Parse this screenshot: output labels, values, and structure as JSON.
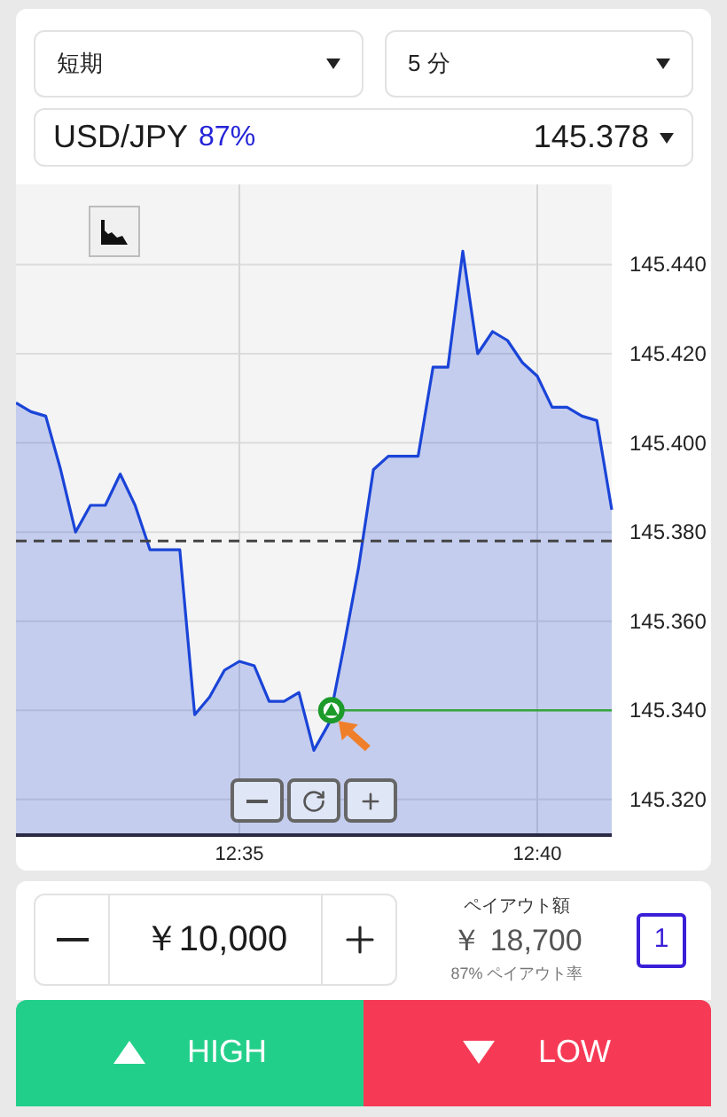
{
  "selectors": [
    {
      "value": "短期"
    },
    {
      "value": "5 分"
    }
  ],
  "asset": {
    "pair": "USD/JPY",
    "payout_rate": "87%",
    "price": "145.378"
  },
  "chart": {
    "chart_data": {
      "type": "area",
      "categories": [
        null,
        null,
        null,
        null,
        null,
        null,
        null,
        null,
        null,
        null,
        null,
        null,
        null,
        null,
        null,
        "12:35",
        null,
        null,
        null,
        null,
        null,
        null,
        null,
        null,
        null,
        null,
        null,
        null,
        null,
        null,
        null,
        null,
        null,
        null,
        null,
        "12:40",
        null,
        null,
        null,
        null,
        null
      ],
      "series": [
        {
          "color": "#1a44d8",
          "values": [
            145.409,
            145.407,
            145.406,
            145.394,
            145.38,
            145.386,
            145.386,
            145.393,
            145.386,
            145.376,
            145.376,
            145.376,
            145.339,
            145.343,
            145.349,
            145.351,
            145.35,
            145.342,
            145.342,
            145.344,
            145.331,
            145.337,
            145.354,
            145.372,
            145.394,
            145.397,
            145.397,
            145.397,
            145.417,
            145.417,
            145.443,
            145.42,
            145.425,
            145.423,
            145.418,
            145.415,
            145.408,
            145.408,
            145.406,
            145.405,
            145.385
          ]
        }
      ],
      "ylim": [
        145.312,
        145.458
      ],
      "yticks": [
        {
          "value": 145.32,
          "label": "145.320"
        },
        {
          "value": 145.34,
          "label": "145.340"
        },
        {
          "value": 145.36,
          "label": "145.360"
        },
        {
          "value": 145.38,
          "label": "145.380"
        },
        {
          "value": 145.4,
          "label": "145.400"
        },
        {
          "value": 145.42,
          "label": "145.420"
        },
        {
          "value": 145.44,
          "label": "145.440"
        }
      ],
      "grid": true,
      "ref_lines": [
        {
          "axis": "y",
          "value": 145.378
        },
        {
          "axis": "y",
          "value": 145.34,
          "color": "#33a53a"
        }
      ]
    }
  },
  "trade": {
    "amount": "￥10,000",
    "payout_label": "ペイアウト額",
    "payout": "￥ 18,700",
    "payout_rate_label": "87% ペイアウト率",
    "count": "1"
  },
  "buttons": [
    {
      "kind": "high",
      "label": "HIGH"
    },
    {
      "kind": "low",
      "label": "LOW"
    }
  ]
}
